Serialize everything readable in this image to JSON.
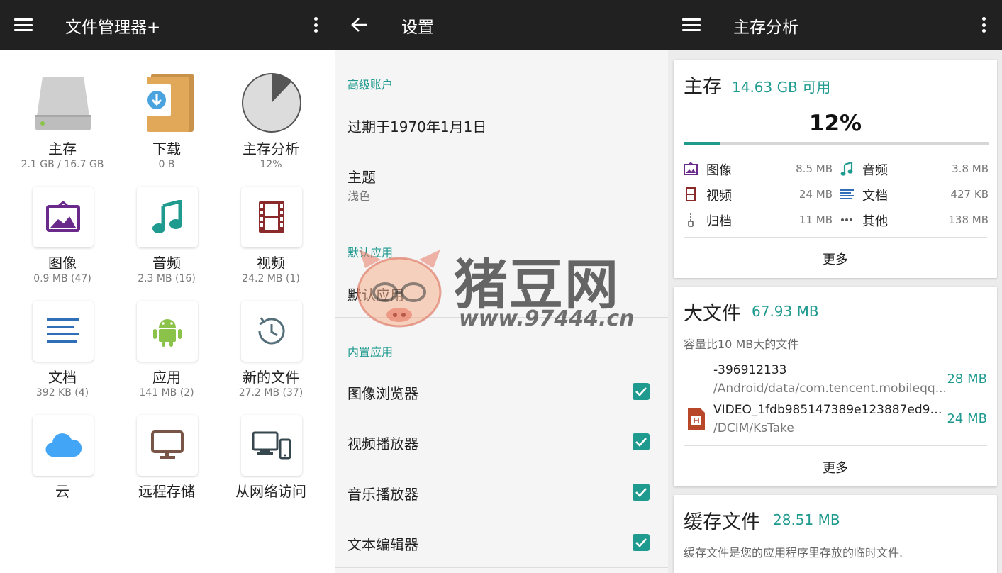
{
  "panel1": {
    "title": "文件管理器+",
    "tiles": [
      {
        "label": "主存",
        "sub": "2.1 GB / 16.7 GB",
        "icon": "drive-icon"
      },
      {
        "label": "下载",
        "sub": "0 B",
        "icon": "download-folder-icon"
      },
      {
        "label": "主存分析",
        "sub": "12%",
        "icon": "pie-chart-icon"
      },
      {
        "label": "图像",
        "sub": "0.9 MB (47)",
        "icon": "image-icon"
      },
      {
        "label": "音频",
        "sub": "2.3 MB (16)",
        "icon": "music-note-icon"
      },
      {
        "label": "视频",
        "sub": "24.2 MB (1)",
        "icon": "film-icon"
      },
      {
        "label": "文档",
        "sub": "392 KB (4)",
        "icon": "document-icon"
      },
      {
        "label": "应用",
        "sub": "141 MB (2)",
        "icon": "android-icon"
      },
      {
        "label": "新的文件",
        "sub": "27.2 MB (37)",
        "icon": "clock-icon"
      },
      {
        "label": "云",
        "sub": "",
        "icon": "cloud-icon"
      },
      {
        "label": "远程存储",
        "sub": "",
        "icon": "monitor-icon"
      },
      {
        "label": "从网络访问",
        "sub": "",
        "icon": "network-devices-icon"
      }
    ],
    "pie_percent": 12
  },
  "panel2": {
    "title": "设置",
    "sections": {
      "premium": "高级账户",
      "expiry": "过期于1970年1月1日",
      "theme_label": "主题",
      "theme_value": "浅色",
      "default_apps_header": "默认应用",
      "default_apps_item": "默认应用",
      "builtin_header": "内置应用",
      "builtin_items": [
        {
          "label": "图像浏览器",
          "checked": true
        },
        {
          "label": "视频播放器",
          "checked": true
        },
        {
          "label": "音乐播放器",
          "checked": true
        },
        {
          "label": "文本编辑器",
          "checked": true
        }
      ]
    }
  },
  "panel3": {
    "title": "主存分析",
    "storage": {
      "title": "主存",
      "available": "14.63 GB 可用",
      "percent_text": "12%",
      "percent": 12,
      "categories": [
        {
          "name": "图像",
          "size": "8.5 MB",
          "icon": "image-icon"
        },
        {
          "name": "音频",
          "size": "3.8 MB",
          "icon": "music-note-icon"
        },
        {
          "name": "视频",
          "size": "24 MB",
          "icon": "film-icon"
        },
        {
          "name": "文档",
          "size": "427 KB",
          "icon": "document-icon"
        },
        {
          "name": "归档",
          "size": "11 MB",
          "icon": "archive-icon"
        },
        {
          "name": "其他",
          "size": "138 MB",
          "icon": "more-dots-icon"
        }
      ],
      "more": "更多"
    },
    "large_files": {
      "title": "大文件",
      "total": "67.93 MB",
      "note": "容量比10 MB大的文件",
      "files": [
        {
          "name": "-396912133",
          "path": "/Android/data/com.tencent.mobileqq...",
          "size": "28 MB"
        },
        {
          "name": "VIDEO_1fdb985147389e123887ed95...",
          "path": "/DCIM/KsTake",
          "size": "24 MB"
        }
      ],
      "more": "更多"
    },
    "cache": {
      "title": "缓存文件",
      "total": "28.51 MB",
      "note": "缓存文件是您的应用程序里存放的临时文件."
    }
  },
  "watermark": {
    "text": "猪豆网",
    "url": "www.97444.cn"
  },
  "colors": {
    "accent": "#1f9a8f",
    "toolbar": "#212121"
  }
}
